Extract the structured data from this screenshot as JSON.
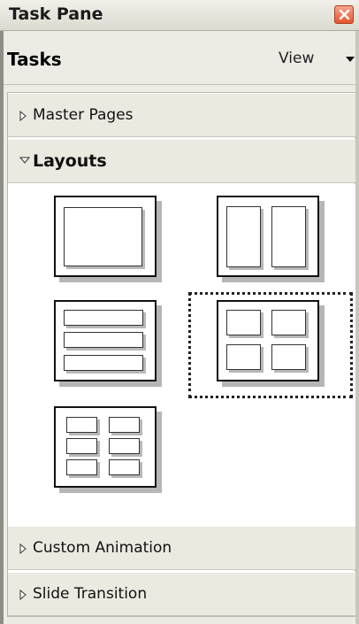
{
  "window": {
    "title": "Task Pane"
  },
  "tasks": {
    "label": "Tasks",
    "view_label": "View"
  },
  "sections": {
    "master_pages": "Master Pages",
    "layouts": "Layouts",
    "custom_animation": "Custom Animation",
    "slide_transition": "Slide Transition"
  },
  "layouts": {
    "selected": "four-content",
    "items": [
      "title-content",
      "two-columns",
      "three-rows",
      "four-content",
      "six-content"
    ]
  },
  "icons": {
    "close": "close-icon",
    "view_dropdown": "chevron-down-icon",
    "collapsed_section": "triangle-right-icon",
    "expanded_section": "triangle-down-icon"
  },
  "colors": {
    "close_button": "#e2552f",
    "panel_bg": "#ecebe4"
  }
}
